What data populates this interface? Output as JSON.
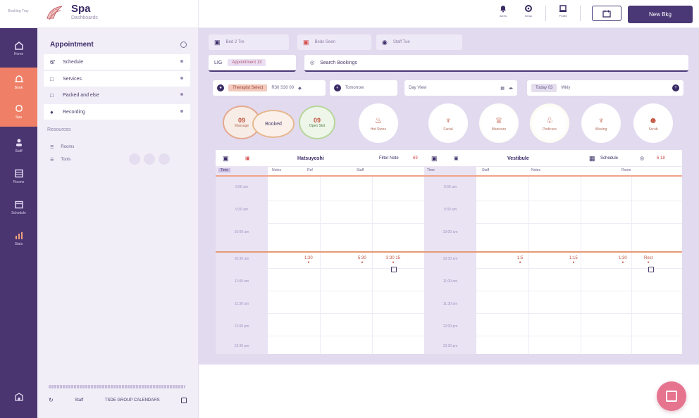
{
  "header": {
    "tiny_label": "Booking Tray",
    "brand_title": "Spa",
    "brand_subtitle": "Dashboards",
    "icons": [
      {
        "name": "bell-icon",
        "label": "Alerts"
      },
      {
        "name": "gear-icon",
        "label": "Setup"
      },
      {
        "name": "user-icon",
        "label": "Profile"
      }
    ],
    "outline_button_icon": "calendar-icon",
    "primary_button_label": "New Bkg"
  },
  "rail": {
    "items": [
      {
        "label": "Home",
        "icon": "home-icon"
      },
      {
        "label": "Book",
        "icon": "bell-icon"
      },
      {
        "label": "Spa",
        "icon": "flower-icon"
      },
      {
        "label": "Staff",
        "icon": "person-icon"
      },
      {
        "label": "Rooms",
        "icon": "grid-icon"
      },
      {
        "label": "Schedule",
        "icon": "calendar-icon"
      },
      {
        "label": "Stats",
        "icon": "chart-icon"
      }
    ],
    "bottom_icon": "building-icon"
  },
  "side": {
    "title": "Appointment",
    "rows": [
      {
        "icon": "6f",
        "label": "Schedule"
      },
      {
        "icon": "□",
        "label": "Services"
      },
      {
        "icon": "□",
        "label": "Packed and else"
      },
      {
        "icon": "●",
        "label": "Recording"
      }
    ],
    "section_label": "Resources",
    "sub_items": [
      {
        "icon": "☰",
        "label": "Rooms"
      },
      {
        "icon": "☰",
        "label": "Tools"
      }
    ],
    "footer_label": "Staff",
    "footer_text": "TSDE GROUP CALENDARS"
  },
  "toolbar": {
    "chips": [
      {
        "icon": "▣",
        "text": "Bed 2 Tre"
      },
      {
        "icon": "▣",
        "text": "Beds Seen"
      },
      {
        "icon": "◉",
        "text": "Staff Tue"
      }
    ],
    "date_field": {
      "left": "LIG",
      "pill": "Appointment 13"
    },
    "search_field": {
      "icon": "◎",
      "text": "Search Bookings"
    },
    "filter1": {
      "badge": "Therapist Select",
      "text": "R30 S30 00",
      "end": "◆"
    },
    "filter2": {
      "text": "Tomorrow"
    },
    "filter3": {
      "text": "Day View"
    },
    "filter4": {
      "badge": "Today 03",
      "text": "Wkly"
    }
  },
  "statuses": [
    {
      "icon": "♨",
      "label": "Hot Stone"
    },
    {
      "icon": "♆",
      "label": "Facial"
    },
    {
      "icon": "♕",
      "label": "Manicure"
    },
    {
      "icon": "♧",
      "label": "Pedicure"
    },
    {
      "icon": "♆",
      "label": "Waxing"
    },
    {
      "icon": "☻",
      "label": "Scrub"
    }
  ],
  "cluster": {
    "a": {
      "num": "09",
      "label": "Massage"
    },
    "b": {
      "label": "Booked"
    },
    "c": {
      "num": "09",
      "label": "Open Slot"
    }
  },
  "calendar_left": {
    "title": "Hatsuyoshi",
    "right_text": "Filter Note",
    "right_num": "69",
    "subs": [
      "Time",
      "Notes",
      "Ref",
      "Staff"
    ],
    "times": [
      "9:00 am",
      "9:30 am",
      "10:00 am",
      "10:30 am",
      "11:00 am",
      "11:30 am",
      "12:00 pm",
      "12:30 pm"
    ],
    "events": [
      {
        "text": "1:30",
        "sub": "●"
      },
      {
        "text": "5:30",
        "sub": "●"
      },
      {
        "text": "3:30 15",
        "sub": "●"
      }
    ]
  },
  "calendar_right": {
    "title": "Vestibule",
    "right_text": "Schedule",
    "right_num": "6 18",
    "subs": [
      "Time",
      "Staff",
      "Notes",
      "Room"
    ],
    "times": [
      "9:00 am",
      "9:30 am",
      "10:00 am",
      "10:30 am",
      "11:00 am",
      "11:30 am",
      "12:00 pm",
      "12:30 pm"
    ],
    "events": [
      {
        "text": "1:5",
        "sub": "●"
      },
      {
        "text": "1:15",
        "sub": "●"
      },
      {
        "text": "1:30",
        "sub": "●"
      },
      {
        "text": "Rest",
        "sub": "●"
      }
    ]
  },
  "colors": {
    "rail": "#4a3570",
    "accent": "#ef7f66",
    "primary": "#4a3876",
    "main_bg": "#e2daef",
    "fab": "#e6748f"
  }
}
